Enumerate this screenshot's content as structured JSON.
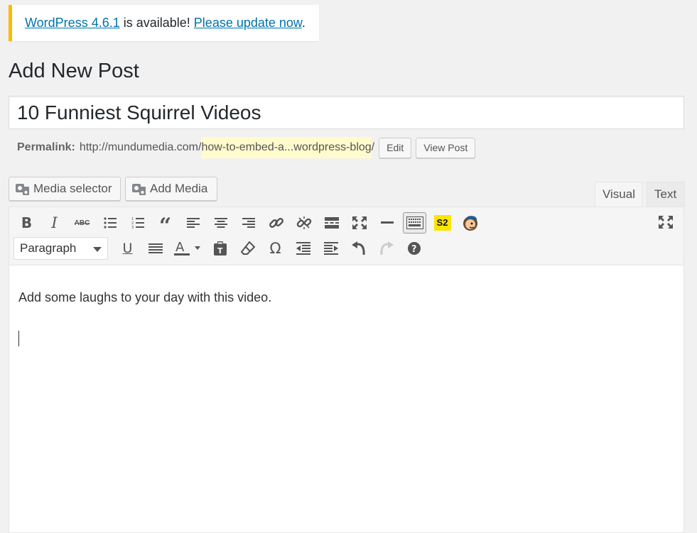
{
  "notice": {
    "version_link": "WordPress 4.6.1",
    "middle_text": " is available! ",
    "update_link": "Please update now",
    "end_text": "."
  },
  "page_title": "Add New Post",
  "post_title": "10 Funniest Squirrel Videos",
  "permalink": {
    "label": "Permalink:",
    "base": "http://mundumedia.com/",
    "slug": "how-to-embed-a...wordpress-blog",
    "trailing": "/",
    "edit_label": "Edit",
    "view_label": "View Post"
  },
  "media": {
    "selector_label": "Media selector",
    "add_label": "Add Media"
  },
  "tabs": {
    "visual": "Visual",
    "text": "Text"
  },
  "toolbar": {
    "format_value": "Paragraph",
    "s2_label": "S2",
    "row1_icons": [
      "bold-icon",
      "italic-icon",
      "strikethrough-icon",
      "bullet-list-icon",
      "numbered-list-icon",
      "blockquote-icon",
      "align-left-icon",
      "align-center-icon",
      "align-right-icon",
      "insert-link-icon",
      "remove-link-icon",
      "read-more-icon",
      "distraction-free-icon",
      "horizontal-line-icon",
      "toolbar-toggle-icon",
      "subscribe2-icon",
      "mailchimp-icon",
      "fullscreen-icon"
    ],
    "row2_icons": [
      "underline-icon",
      "justify-icon",
      "text-color-icon",
      "paste-as-text-icon",
      "clear-formatting-icon",
      "special-character-icon",
      "outdent-icon",
      "indent-icon",
      "undo-icon",
      "redo-icon",
      "help-icon"
    ]
  },
  "content": {
    "paragraph": "Add some laughs to your day with this video."
  },
  "colors": {
    "link": "#0073aa",
    "notice_accent": "#ffb900",
    "s2_badge": "#ffe400",
    "slug_highlight": "#fffbcc"
  }
}
